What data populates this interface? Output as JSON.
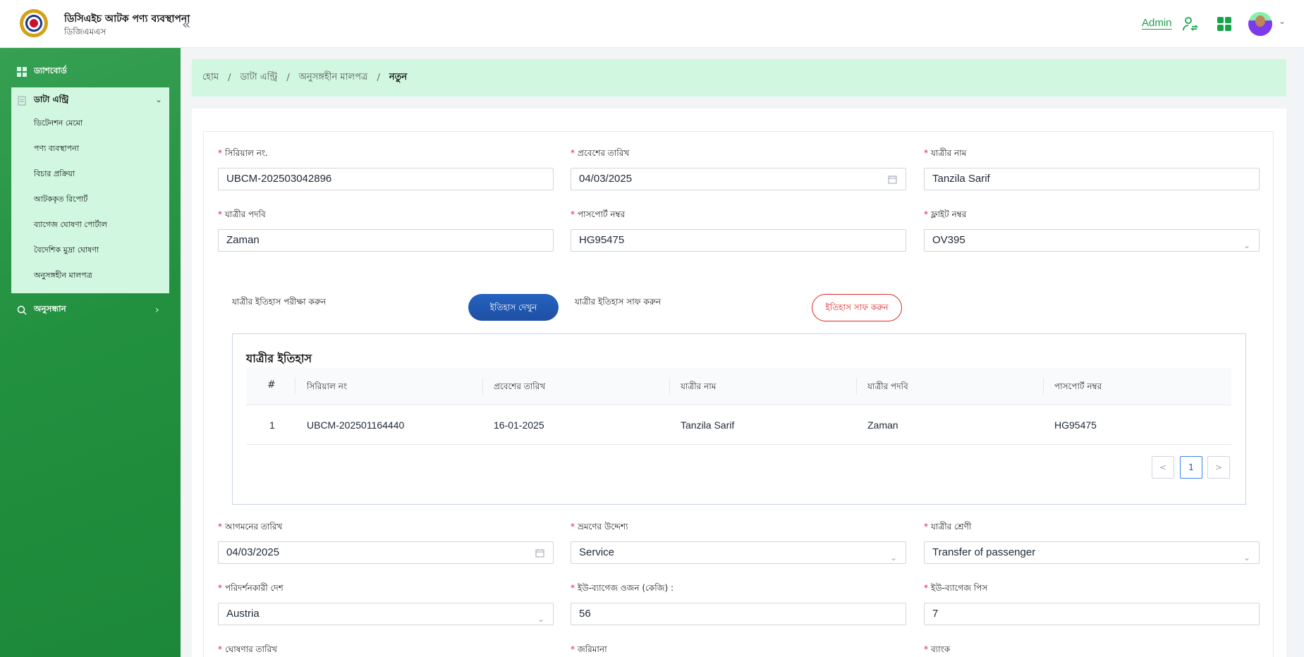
{
  "header": {
    "app_title": "ডিসিএইচ আটক পণ্য ব্যবস্থাপনা",
    "app_subtitle": "ডিজিএমএস",
    "collapse_icon": "double-chevron-left-icon",
    "user_link": "Admin",
    "accent_color": "#16a34a"
  },
  "sidebar": {
    "dashboard": "ড্যাশবোর্ড",
    "data_entry": "ডাটা এন্ট্রি",
    "sub_items": [
      "ডিটেনশন মেমো",
      "পণ্য ব্যবস্থাপনা",
      "বিচার প্রক্রিয়া",
      "আটককৃত রিপোর্ট",
      "ব্যাগেজ ঘোষণা পোর্টাল",
      "বৈদেশিক মুদ্রা ঘোষণা",
      "অনুসঙ্গহীন মালপত্র"
    ],
    "search": "অনুসন্ধান"
  },
  "breadcrumb": [
    "হোম",
    "ডাটা এন্ট্রি",
    "অনুসঙ্গহীন মালপত্র",
    "নতুন"
  ],
  "form": {
    "serial_label": "সিরিয়াল নং.",
    "serial_value": "UBCM-202503042896",
    "entry_date_label": "প্রবেশের তারিখ",
    "entry_date_value": "04/03/2025",
    "passenger_name_label": "যাত্রীর নাম",
    "passenger_name_value": "Tanzila Sarif",
    "passenger_title_label": "যাত্রীর পদবি",
    "passenger_title_value": "Zaman",
    "passport_label": "পাসপোর্ট নম্বর",
    "passport_value": "HG95475",
    "flight_label": "ফ্লাইট নম্বর",
    "flight_value": "OV395",
    "arrival_date_label": "আগমনের তারিখ",
    "arrival_date_value": "04/03/2025",
    "travel_purpose_label": "ভ্রমণের উদ্দেশ্য",
    "travel_purpose_value": "Service",
    "passenger_class_label": "যাত্রীর শ্রেণী",
    "passenger_class_value": "Transfer of passenger",
    "visited_country_label": "পরিদর্শনকারী দেশ",
    "visited_country_value": "Austria",
    "baggage_weight_label": "ইউ-ব্যাগেজ ওজন (কেজি) :",
    "baggage_weight_value": "56",
    "baggage_pieces_label": "ইউ-ব্যাগেজ পিস",
    "baggage_pieces_value": "7",
    "declaration_date_label": "ঘোষণার তারিখ",
    "fine_label": "জরিমানা",
    "bank_label": "ব্যাংক"
  },
  "history_actions": {
    "check_text": "যাত্রীর ইতিহাস পরীক্ষা করুন",
    "view_button": "ইতিহাস দেখুন",
    "clear_text": "যাত্রীর ইতিহাস সাফ করুন",
    "clear_button": "ইতিহাস সাফ করুন"
  },
  "history": {
    "title": "যাত্রীর ইতিহাস",
    "columns": [
      "#",
      "সিরিয়াল নং",
      "প্রবেশের তারিখ",
      "যাত্রীর নাম",
      "যাত্রীর পদবি",
      "পাসপোর্ট নম্বর"
    ],
    "rows": [
      [
        "1",
        "UBCM-202501164440",
        "16-01-2025",
        "Tanzila Sarif",
        "Zaman",
        "HG95475"
      ]
    ],
    "pagination": {
      "prev": "<",
      "current": "1",
      "next": ">"
    }
  }
}
